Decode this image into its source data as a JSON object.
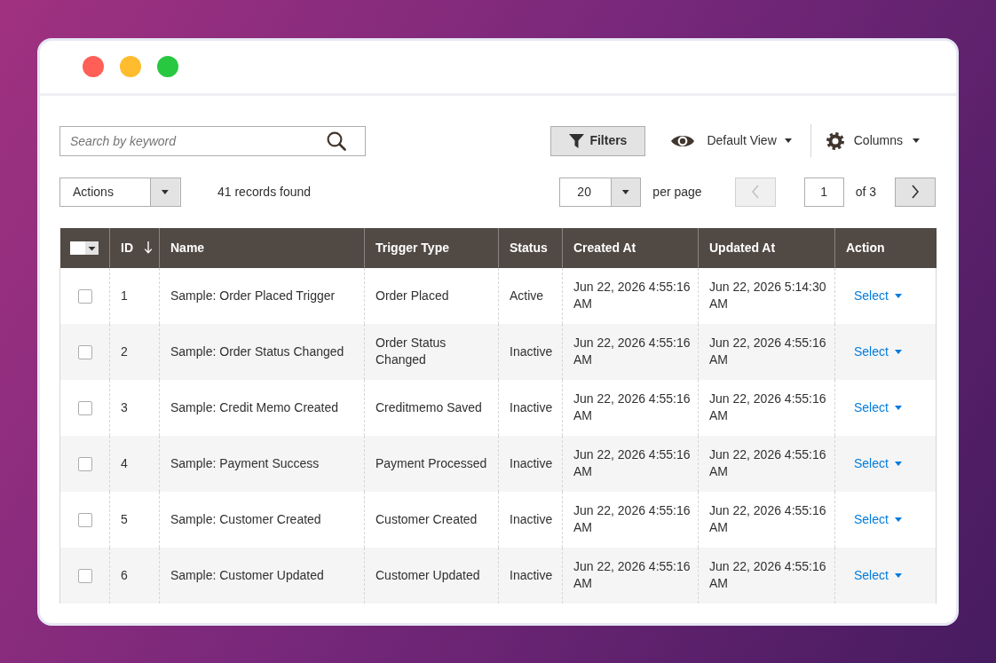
{
  "search": {
    "placeholder": "Search by keyword"
  },
  "toolbar": {
    "filters": "Filters",
    "view": "Default View",
    "columns": "Columns"
  },
  "mass_actions": {
    "label": "Actions",
    "records_found": "41 records found"
  },
  "pagination": {
    "page_size": "20",
    "per_page_label": "per page",
    "previous_disabled": true,
    "page": "1",
    "page_count": "of 3",
    "next_disabled": false
  },
  "table": {
    "select_all": {
      "checked": false
    },
    "columns": [
      {
        "label": "ID",
        "sorted": true
      },
      {
        "label": "Name",
        "sorted": false
      },
      {
        "label": "Trigger Type",
        "sorted": false
      },
      {
        "label": "Status",
        "sorted": false
      },
      {
        "label": "Created At",
        "sorted": false
      },
      {
        "label": "Updated At",
        "sorted": false
      },
      {
        "label": "Action",
        "sorted": false
      }
    ],
    "rows": [
      {
        "selected": false,
        "cells": [
          "1",
          "Sample: Order Placed Trigger",
          "Order Placed",
          "Active",
          "Jun 22, 2026 4:55:16 AM",
          "Jun 22, 2026 5:14:30 AM"
        ],
        "action": "Select"
      },
      {
        "selected": false,
        "cells": [
          "2",
          "Sample: Order Status Changed",
          "Order Status Changed",
          "Inactive",
          "Jun 22, 2026 4:55:16 AM",
          "Jun 22, 2026 4:55:16 AM"
        ],
        "action": "Select"
      },
      {
        "selected": false,
        "cells": [
          "3",
          "Sample: Credit Memo Created",
          "Creditmemo Saved",
          "Inactive",
          "Jun 22, 2026 4:55:16 AM",
          "Jun 22, 2026 4:55:16 AM"
        ],
        "action": "Select"
      },
      {
        "selected": false,
        "cells": [
          "4",
          "Sample: Payment Success",
          "Payment Processed",
          "Inactive",
          "Jun 22, 2026 4:55:16 AM",
          "Jun 22, 2026 4:55:16 AM"
        ],
        "action": "Select"
      },
      {
        "selected": false,
        "cells": [
          "5",
          "Sample: Customer Created",
          "Customer Created",
          "Inactive",
          "Jun 22, 2026 4:55:16 AM",
          "Jun 22, 2026 4:55:16 AM"
        ],
        "action": "Select"
      },
      {
        "selected": false,
        "cells": [
          "6",
          "Sample: Customer Updated",
          "Customer Updated",
          "Inactive",
          "Jun 22, 2026 4:55:16 AM",
          "Jun 22, 2026 4:55:16 AM"
        ],
        "action": "Select"
      }
    ]
  }
}
